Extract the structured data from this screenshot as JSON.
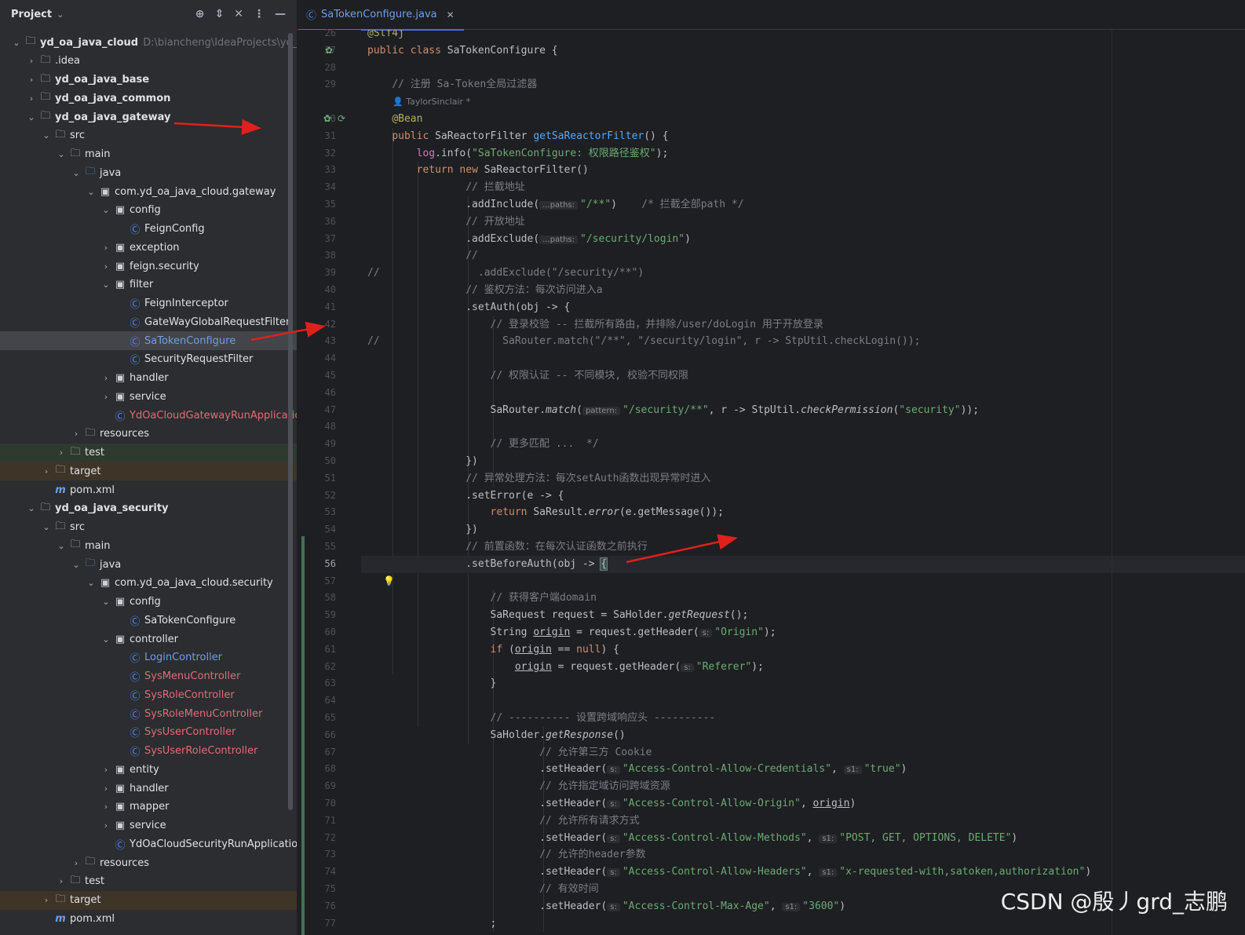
{
  "project_panel": {
    "title": "Project",
    "tree": [
      {
        "label": "yd_oa_java_cloud",
        "path": "D:\\biancheng\\IdeaProjects\\yd_oa_",
        "type": "module",
        "bold": true,
        "expanded": true,
        "arrow": true
      },
      {
        "label": ".idea",
        "type": "folder",
        "arrow": true
      },
      {
        "label": "yd_oa_java_base",
        "type": "module",
        "bold": true,
        "arrow": true
      },
      {
        "label": "yd_oa_java_common",
        "type": "module",
        "bold": true,
        "arrow": true
      },
      {
        "label": "yd_oa_java_gateway",
        "type": "module",
        "bold": true,
        "expanded": true,
        "arrow": true
      },
      {
        "label": "src",
        "type": "folder",
        "expanded": true,
        "arrow": true
      },
      {
        "label": "main",
        "type": "folder",
        "expanded": true,
        "arrow": true
      },
      {
        "label": "java",
        "type": "src",
        "expanded": true,
        "arrow": true
      },
      {
        "label": "com.yd_oa_java_cloud.gateway",
        "type": "pkg",
        "expanded": true,
        "arrow": true
      },
      {
        "label": "config",
        "type": "pkg",
        "expanded": true,
        "arrow": true
      },
      {
        "label": "FeignConfig",
        "type": "class"
      },
      {
        "label": "exception",
        "type": "pkg",
        "arrow": true
      },
      {
        "label": "feign.security",
        "type": "pkg",
        "arrow": true
      },
      {
        "label": "filter",
        "type": "pkg",
        "expanded": true,
        "arrow": true
      },
      {
        "label": "FeignInterceptor",
        "type": "class"
      },
      {
        "label": "GateWayGlobalRequestFilter",
        "type": "class"
      },
      {
        "label": "SaTokenConfigure",
        "type": "class",
        "selected": true,
        "color": "blue"
      },
      {
        "label": "SecurityRequestFilter",
        "type": "class"
      },
      {
        "label": "handler",
        "type": "pkg",
        "arrow": true
      },
      {
        "label": "service",
        "type": "pkg",
        "arrow": true
      },
      {
        "label": "YdOaCloudGatewayRunApplication",
        "type": "class",
        "color": "red"
      },
      {
        "label": "resources",
        "type": "folder",
        "arrow": true
      },
      {
        "label": "test",
        "type": "folder",
        "arrow": true,
        "bg": "green"
      },
      {
        "label": "target",
        "type": "folder",
        "arrow": true,
        "bg": "brown"
      },
      {
        "label": "pom.xml",
        "type": "maven"
      },
      {
        "label": "yd_oa_java_security",
        "type": "module",
        "bold": true,
        "expanded": true,
        "arrow": true
      },
      {
        "label": "src",
        "type": "folder",
        "expanded": true,
        "arrow": true
      },
      {
        "label": "main",
        "type": "folder",
        "expanded": true,
        "arrow": true
      },
      {
        "label": "java",
        "type": "src",
        "expanded": true,
        "arrow": true
      },
      {
        "label": "com.yd_oa_java_cloud.security",
        "type": "pkg",
        "expanded": true,
        "arrow": true
      },
      {
        "label": "config",
        "type": "pkg",
        "expanded": true,
        "arrow": true
      },
      {
        "label": "SaTokenConfigure",
        "type": "class"
      },
      {
        "label": "controller",
        "type": "pkg",
        "expanded": true,
        "arrow": true
      },
      {
        "label": "LoginController",
        "type": "class",
        "color": "blue"
      },
      {
        "label": "SysMenuController",
        "type": "class",
        "color": "red"
      },
      {
        "label": "SysRoleController",
        "type": "class",
        "color": "red"
      },
      {
        "label": "SysRoleMenuController",
        "type": "class",
        "color": "red"
      },
      {
        "label": "SysUserController",
        "type": "class",
        "color": "red"
      },
      {
        "label": "SysUserRoleController",
        "type": "class",
        "color": "red"
      },
      {
        "label": "entity",
        "type": "pkg",
        "arrow": true
      },
      {
        "label": "handler",
        "type": "pkg",
        "arrow": true
      },
      {
        "label": "mapper",
        "type": "pkg",
        "arrow": true
      },
      {
        "label": "service",
        "type": "pkg",
        "arrow": true
      },
      {
        "label": "YdOaCloudSecurityRunApplication",
        "type": "class"
      },
      {
        "label": "resources",
        "type": "folder",
        "arrow": true
      },
      {
        "label": "test",
        "type": "folder",
        "arrow": true
      },
      {
        "label": "target",
        "type": "folder",
        "arrow": true,
        "bg": "brown"
      },
      {
        "label": "pom.xml",
        "type": "maven"
      }
    ]
  },
  "editor": {
    "tab_label": "SaTokenConfigure.java",
    "current_line": 56,
    "author_hint": "TaylorSinclair *",
    "lines": [
      {
        "n": "26",
        "html": "<span class=\"an\">@Slf4j</span>"
      },
      {
        "n": "27",
        "html": "<span class=\"kw\">public class</span> SaTokenConfigure {"
      },
      {
        "n": "28",
        "html": ""
      },
      {
        "n": "29",
        "html": "    <span class=\"cm\">// 注册 Sa-Token全局过滤器</span>"
      },
      {
        "n": "",
        "html": ""
      },
      {
        "n": "30",
        "html": "    <span class=\"an\">@Bean</span>"
      },
      {
        "n": "31",
        "html": "    <span class=\"kw\">public</span> SaReactorFilter <span class=\"fn\">getSaReactorFilter</span>() {"
      },
      {
        "n": "32",
        "html": "        <span class=\"fld\">log</span>.info(<span class=\"str\">\"SaTokenConfigure: 权限路径鉴权\"</span>);"
      },
      {
        "n": "33",
        "html": "        <span class=\"kw\">return new</span> SaReactorFilter()"
      },
      {
        "n": "34",
        "html": "                <span class=\"cm\">// 拦截地址</span>"
      },
      {
        "n": "35",
        "html": "                .addInclude(<span class=\"hint\">...paths:</span><span class=\"str\">\"/**\"</span>)    <span class=\"cm\">/* 拦截全部path */</span>"
      },
      {
        "n": "36",
        "html": "                <span class=\"cm\">// 开放地址</span>"
      },
      {
        "n": "37",
        "html": "                .addExclude(<span class=\"hint\">...paths:</span><span class=\"str\">\"/security/login\"</span>)"
      },
      {
        "n": "38",
        "html": "                <span class=\"cm\">//</span>"
      },
      {
        "n": "39",
        "html": "<span class=\"cm\">//                .addExclude(\"/security/**\")</span>"
      },
      {
        "n": "40",
        "html": "                <span class=\"cm\">// 鉴权方法：每次访问进入a</span>"
      },
      {
        "n": "41",
        "html": "                .setAuth(obj -&gt; {"
      },
      {
        "n": "42",
        "html": "                    <span class=\"cm\">// 登录校验 -- 拦截所有路由，并排除/user/doLogin 用于开放登录</span>"
      },
      {
        "n": "43",
        "html": "<span class=\"cm\">//                    SaRouter.match(\"/**\", \"/security/login\", r -&gt; StpUtil.checkLogin());</span>"
      },
      {
        "n": "44",
        "html": ""
      },
      {
        "n": "45",
        "html": "                    <span class=\"cm\">// 权限认证 -- 不同模块, 校验不同权限</span>"
      },
      {
        "n": "46",
        "html": ""
      },
      {
        "n": "47",
        "html": "                    SaRouter.<span class=\"it\">match</span>(<span class=\"hint\">pattern:</span><span class=\"str\">\"/security/**\"</span>, r -&gt; StpUtil.<span class=\"it\">checkPermission</span>(<span class=\"str\">\"security\"</span>));"
      },
      {
        "n": "48",
        "html": ""
      },
      {
        "n": "49",
        "html": "                    <span class=\"cm\">// 更多匹配 ...  */</span>"
      },
      {
        "n": "50",
        "html": "                })"
      },
      {
        "n": "51",
        "html": "                <span class=\"cm\">// 异常处理方法：每次setAuth函数出现异常时进入</span>"
      },
      {
        "n": "52",
        "html": "                .setError(e -&gt; {"
      },
      {
        "n": "53",
        "html": "                    <span class=\"kw\">return</span> SaResult.<span class=\"it\">error</span>(e.getMessage());"
      },
      {
        "n": "54",
        "html": "                })"
      },
      {
        "n": "55",
        "html": "                <span class=\"cm\">// 前置函数：在每次认证函数之前执行</span>"
      },
      {
        "n": "56",
        "html": "                .setBeforeAuth(obj -&gt; <span class=\"brace-hl\">{</span>"
      },
      {
        "n": "57",
        "html": ""
      },
      {
        "n": "58",
        "html": "                    <span class=\"cm\">// 获得客户端domain</span>"
      },
      {
        "n": "59",
        "html": "                    SaRequest request = SaHolder.<span class=\"it\">getRequest</span>();"
      },
      {
        "n": "60",
        "html": "                    String <span class=\"ul\">origin</span> = request.getHeader(<span class=\"hint\">s:</span><span class=\"str\">\"Origin\"</span>);"
      },
      {
        "n": "61",
        "html": "                    <span class=\"kw\">if</span> (<span class=\"ul\">origin</span> == <span class=\"kw\">null</span>) {"
      },
      {
        "n": "62",
        "html": "                        <span class=\"ul\">origin</span> = request.getHeader(<span class=\"hint\">s:</span><span class=\"str\">\"Referer\"</span>);"
      },
      {
        "n": "63",
        "html": "                    }"
      },
      {
        "n": "64",
        "html": ""
      },
      {
        "n": "65",
        "html": "                    <span class=\"cm\">// ---------- 设置跨域响应头 ----------</span>"
      },
      {
        "n": "66",
        "html": "                    SaHolder.<span class=\"it\">getResponse</span>()"
      },
      {
        "n": "67",
        "html": "                            <span class=\"cm\">// 允许第三方 Cookie</span>"
      },
      {
        "n": "68",
        "html": "                            .setHeader(<span class=\"hint\">s:</span><span class=\"str\">\"Access-Control-Allow-Credentials\"</span>, <span class=\"hint\">s1:</span><span class=\"str\">\"true\"</span>)"
      },
      {
        "n": "69",
        "html": "                            <span class=\"cm\">// 允许指定域访问跨域资源</span>"
      },
      {
        "n": "70",
        "html": "                            .setHeader(<span class=\"hint\">s:</span><span class=\"str\">\"Access-Control-Allow-Origin\"</span>, <span class=\"ul\">origin</span>)"
      },
      {
        "n": "71",
        "html": "                            <span class=\"cm\">// 允许所有请求方式</span>"
      },
      {
        "n": "72",
        "html": "                            .setHeader(<span class=\"hint\">s:</span><span class=\"str\">\"Access-Control-Allow-Methods\"</span>, <span class=\"hint\">s1:</span><span class=\"str\">\"POST, GET, OPTIONS, DELETE\"</span>)"
      },
      {
        "n": "73",
        "html": "                            <span class=\"cm\">// 允许的header参数</span>"
      },
      {
        "n": "74",
        "html": "                            .setHeader(<span class=\"hint\">s:</span><span class=\"str\">\"Access-Control-Allow-Headers\"</span>, <span class=\"hint\">s1:</span><span class=\"str\">\"x-requested-with,satoken,authorization\"</span>)"
      },
      {
        "n": "75",
        "html": "                            <span class=\"cm\">// 有效时间</span>"
      },
      {
        "n": "76",
        "html": "                            .setHeader(<span class=\"hint\">s:</span><span class=\"str\">\"Access-Control-Max-Age\"</span>, <span class=\"hint\">s1:</span><span class=\"str\">\"3600\"</span>)"
      },
      {
        "n": "77",
        "html": "                    ;"
      }
    ]
  },
  "watermark": "CSDN @殷丿grd_志鹏",
  "colors": {
    "annotation_arrow": "#e0201c",
    "accent": "#3574f0"
  }
}
